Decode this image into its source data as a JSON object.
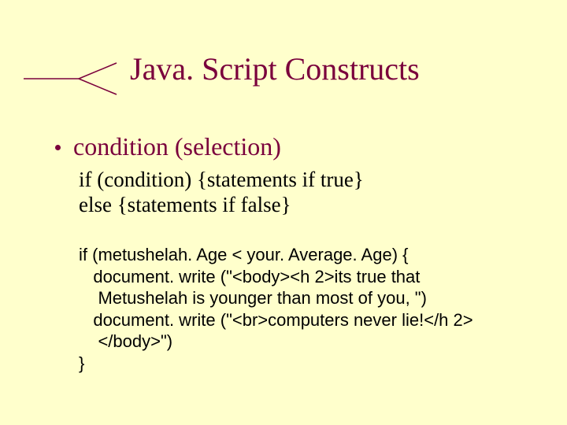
{
  "title": "Java. Script Constructs",
  "bullet": "condition (selection)",
  "syntax": {
    "line1": "if (condition) {statements if true}",
    "line2": "else {statements if false}"
  },
  "code": {
    "l1": "if (metushelah. Age < your. Average. Age) {",
    "l2": "   document. write (\"<body><h 2>its true that",
    "l3": "    Metushelah is younger than most of you, \")",
    "l4": "   document. write (\"<br>computers never lie!</h 2>",
    "l5": "    </body>\")",
    "l6": "}"
  }
}
